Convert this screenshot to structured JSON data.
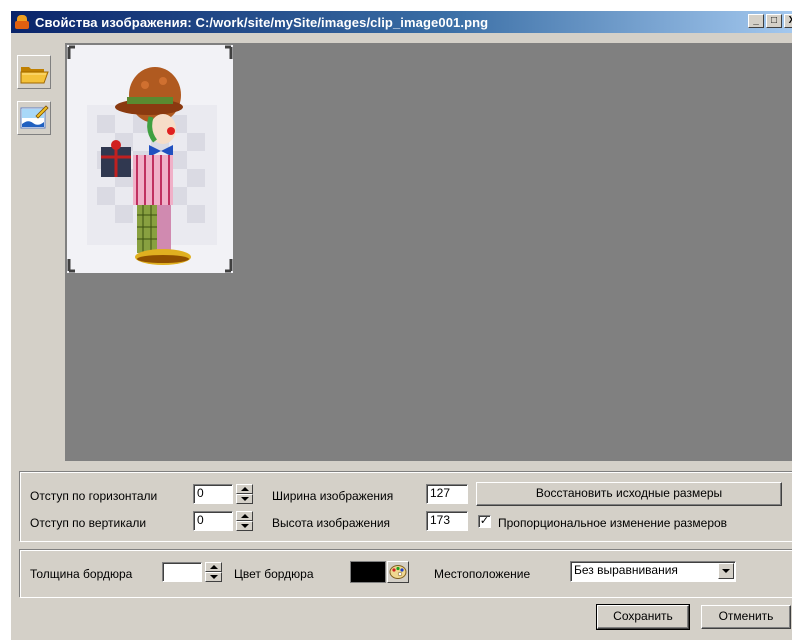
{
  "window": {
    "title": "Свойства изображения: C:/work/site/mySite/images/clip_image001.png",
    "buttons": {
      "minimize": "_",
      "maximize": "□",
      "close": "X"
    }
  },
  "toolbar": {
    "open_icon": "folder-open-icon",
    "edit_icon": "image-edit-icon"
  },
  "preview": {
    "background_color": "#808080",
    "image_description_icon": "clown-clipart-image"
  },
  "dimensions": {
    "hspace_label": "Отступ по горизонтали",
    "hspace_value": "0",
    "vspace_label": "Отступ по вертикали",
    "vspace_value": "0",
    "width_label": "Ширина изображения",
    "width_value": "127",
    "height_label": "Высота изображения",
    "height_value": "173",
    "restore_button": "Восстановить исходные размеры",
    "proportional_label": "Пропорциональное изменение размеров",
    "proportional_checked": true
  },
  "border": {
    "thickness_label": "Толщина бордюра",
    "thickness_value": "",
    "color_label": "Цвет бордюра",
    "color_value": "#000000",
    "position_label": "Местоположение",
    "position_value": "Без выравнивания"
  },
  "actions": {
    "save": "Сохранить",
    "cancel": "Отменить"
  }
}
